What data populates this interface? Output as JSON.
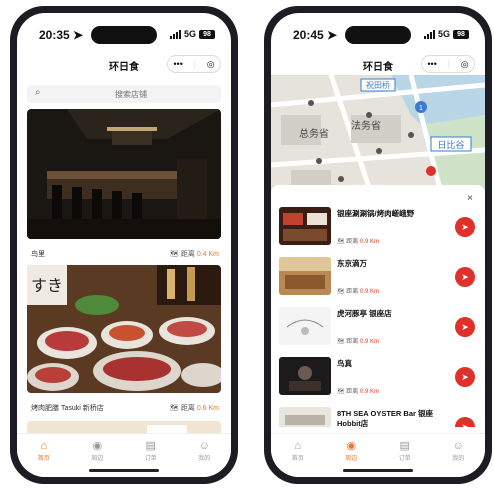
{
  "phone1": {
    "time": "20:35",
    "network": "5G",
    "battery": "98",
    "title": "环日食",
    "capsule_more": "•••",
    "capsule_target": "◎",
    "search_placeholder": "搜索店铺",
    "cards": [
      {
        "name": "鸟里",
        "distance_label": "距离",
        "distance_value": "0.4 Km"
      },
      {
        "name": "烤肉肥膳 Tasuki 新桥店",
        "distance_label": "距离",
        "distance_value": "0.6 Km"
      }
    ],
    "tabs": [
      {
        "label": "首页",
        "icon": "home-icon"
      },
      {
        "label": "周边",
        "icon": "nearby-icon"
      },
      {
        "label": "订单",
        "icon": "order-icon"
      },
      {
        "label": "我的",
        "icon": "profile-icon"
      }
    ],
    "active_tab": 0
  },
  "phone2": {
    "time": "20:45",
    "network": "5G",
    "battery": "98",
    "title": "环日食",
    "capsule_more": "•••",
    "capsule_target": "◎",
    "map_labels": {
      "station1": "祝田桥",
      "district": "总务省",
      "ministry": "法务省",
      "station2": "日比谷",
      "line_num": "1"
    },
    "close": "×",
    "restaurants": [
      {
        "name": "银座涮涮锅/烤肉嵯峨野",
        "distance_label": "距离",
        "distance_value": "0.9 Km"
      },
      {
        "name": "东京滴万",
        "distance_label": "距离",
        "distance_value": "0.9 Km"
      },
      {
        "name": "虎河豚亭 银座店",
        "distance_label": "距离",
        "distance_value": "0.9 Km"
      },
      {
        "name": "鸟真",
        "distance_label": "距离",
        "distance_value": "0.9 Km"
      },
      {
        "name": "8TH SEA OYSTER Bar 银座Hobbit店",
        "distance_label": "距离",
        "distance_value": "0.9 Km"
      }
    ],
    "tabs": [
      {
        "label": "首页",
        "icon": "home-icon"
      },
      {
        "label": "周边",
        "icon": "nearby-icon"
      },
      {
        "label": "订单",
        "icon": "order-icon"
      },
      {
        "label": "我的",
        "icon": "profile-icon"
      }
    ],
    "active_tab": 1
  },
  "colors": {
    "accent": "#e8772a",
    "nav_button": "#e0302a",
    "frame": "#1d1c24"
  }
}
